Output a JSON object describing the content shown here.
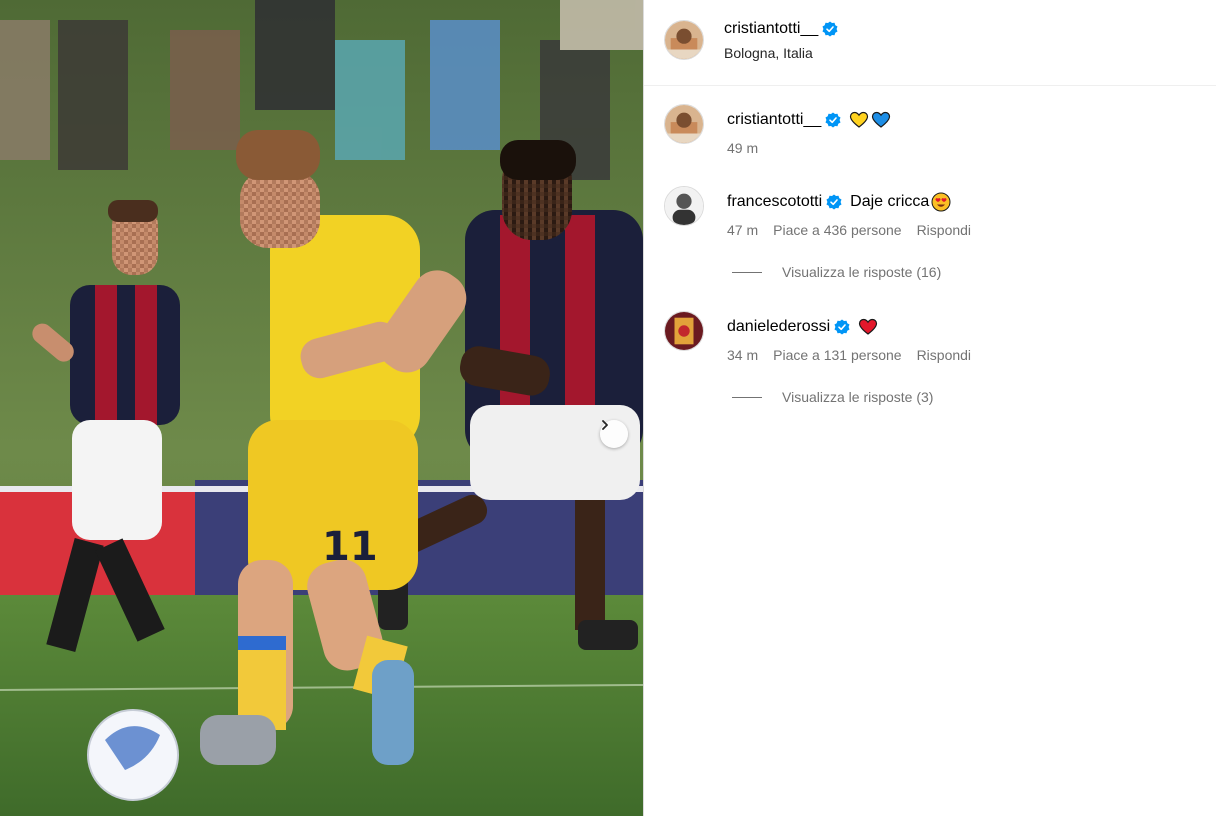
{
  "post": {
    "author": "cristiantotti__",
    "location": "Bologna, Italia"
  },
  "caption": {
    "user": "cristiantotti__",
    "emojis": [
      "yellow-heart",
      "blue-heart"
    ],
    "time": "49 m"
  },
  "comments": [
    {
      "user": "francescototti",
      "text": "Daje cricca",
      "emoji": "heart-eyes",
      "time": "47 m",
      "likes": "Piace a 436 persone",
      "reply_label": "Rispondi",
      "view_replies": "Visualizza le risposte (16)"
    },
    {
      "user": "danielederossi",
      "text": "",
      "emoji": "red-heart",
      "time": "34 m",
      "likes": "Piace a 131 persone",
      "reply_label": "Rispondi",
      "view_replies": "Visualizza le risposte (3)"
    }
  ],
  "colors": {
    "verified": "#0095f6",
    "meta_text": "#737373",
    "jersey_yellow": "#f2d224",
    "jersey_red": "#a3172d",
    "jersey_navy": "#1b1f3a"
  }
}
